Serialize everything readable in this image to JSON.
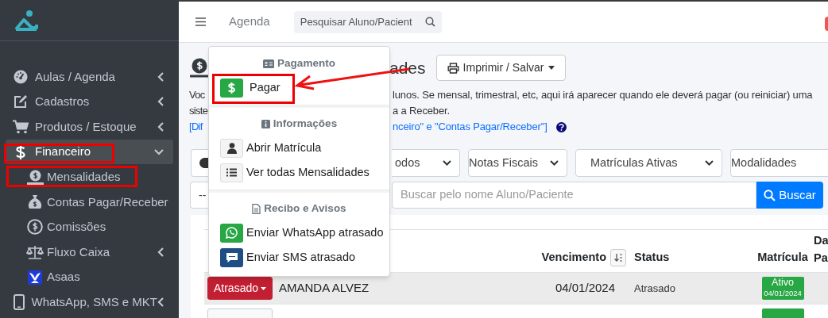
{
  "sidebar": {
    "items": [
      {
        "label": "Aulas / Agenda",
        "expanded": false,
        "selected": false
      },
      {
        "label": "Cadastros",
        "expanded": false,
        "selected": false
      },
      {
        "label": "Produtos / Estoque",
        "expanded": false,
        "selected": false
      },
      {
        "label": "Financeiro",
        "expanded": true,
        "selected": true,
        "children": [
          {
            "label": "Mensalidades"
          },
          {
            "label": "Contas Pagar/Receber"
          },
          {
            "label": "Comissões"
          },
          {
            "label": "Fluxo Caixa",
            "expanded": false
          },
          {
            "label": "Asaas"
          }
        ]
      },
      {
        "label": "WhatsApp, SMS e MKT",
        "expanded": false,
        "selected": false
      }
    ]
  },
  "topbar": {
    "nav_link": "Agenda",
    "search": {
      "placeholder": "Pesquisar Aluno/Pacient"
    }
  },
  "page": {
    "title": "ades",
    "print_button": "Imprimir / Salvar",
    "description": [
      {
        "left": "Voc",
        "right": "lunos. Se mensal, trimestral, etc, aqui irá aparecer quando ele deverá pagar (ou reiniciar) uma"
      },
      {
        "left": "siste",
        "right": "a a Receber."
      }
    ],
    "link": {
      "left": "[Dif",
      "right": "nceiro\" e \"Contas Pagar/Receber\"]"
    }
  },
  "filters": [
    "odos",
    "Notas Fiscais",
    "Matrículas Ativas",
    "Modalidades"
  ],
  "search_row": {
    "select": "--",
    "search": {
      "placeholder": "Buscar pelo nome Aluno/Paciente"
    },
    "button": "Buscar"
  },
  "table": {
    "columns": [
      {
        "label": "Vencimento",
        "sortable": true
      },
      {
        "label": "Status",
        "sortable": false
      },
      {
        "label": "Matrícula",
        "sortable": false
      },
      {
        "lines": [
          "Da",
          "Pa"
        ]
      }
    ],
    "rows": [
      {
        "status_button": {
          "label": "Atrasado",
          "kind": "late"
        },
        "name": "AMANDA ALVEZ",
        "due": "04/01/2024",
        "status": "Atrasado",
        "enrollment": {
          "kind": "active",
          "label": "Ativo",
          "date": "04/01/2024"
        },
        "highlighted": true
      },
      {
        "status_button": {
          "kind": "ok"
        },
        "enrollment": {
          "kind": "active"
        },
        "highlighted": false
      }
    ]
  },
  "dropdown": {
    "sections": [
      {
        "header": "Pagamento",
        "items": [
          {
            "label": "Pagar",
            "kind": "pay"
          }
        ]
      },
      {
        "header": "Informações",
        "items": [
          {
            "label": "Abrir Matrícula",
            "kind": "person"
          },
          {
            "label": "Ver todas Mensalidades",
            "kind": "list"
          }
        ]
      },
      {
        "header": "Recibo e Avisos",
        "items": [
          {
            "label": "Enviar WhatsApp atrasado",
            "kind": "whatsapp"
          },
          {
            "label": "Enviar SMS atrasado",
            "kind": "sms"
          }
        ]
      }
    ]
  }
}
